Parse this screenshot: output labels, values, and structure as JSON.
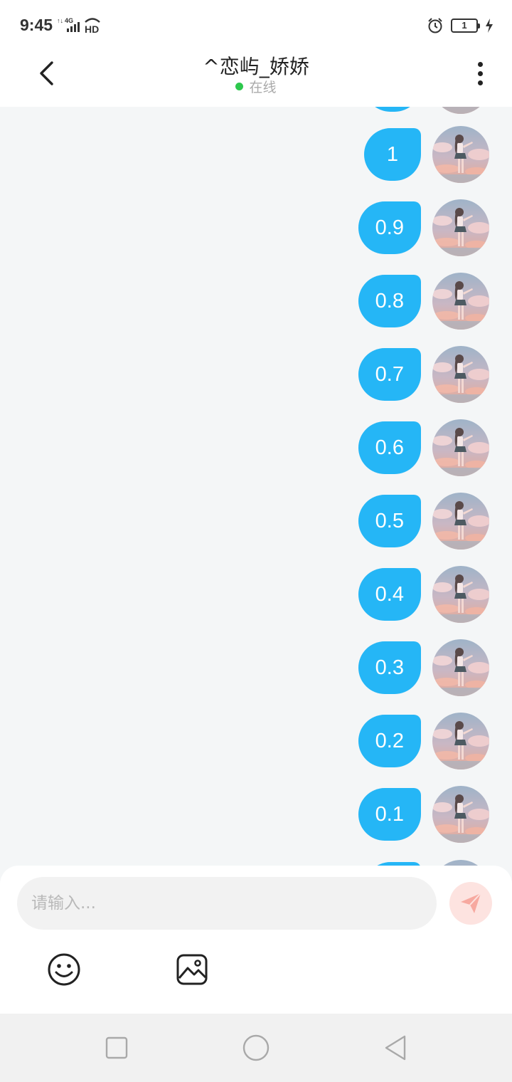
{
  "status_bar": {
    "time": "9:45",
    "network": "4G",
    "hd": "HD",
    "battery": "1"
  },
  "header": {
    "title": "^恋屿_娇娇",
    "status": "在线",
    "status_color": "#2dc84d"
  },
  "messages": [
    {
      "text": "1"
    },
    {
      "text": "0.9"
    },
    {
      "text": "0.8"
    },
    {
      "text": "0.7"
    },
    {
      "text": "0.6"
    },
    {
      "text": "0.5"
    },
    {
      "text": "0.4"
    },
    {
      "text": "0.3"
    },
    {
      "text": "0.2"
    },
    {
      "text": "0.1"
    }
  ],
  "input": {
    "placeholder": "请输入...",
    "value": ""
  },
  "colors": {
    "bubble": "#25b6f6",
    "send_button": "#fde3e0",
    "send_icon": "#f7a9a0"
  },
  "icons": {
    "back": "chevron-left-icon",
    "more": "more-vertical-icon",
    "send": "paper-plane-icon",
    "emoji": "smiley-icon",
    "image": "image-icon",
    "nav_recent": "square-icon",
    "nav_home": "circle-icon",
    "nav_back": "triangle-back-icon"
  }
}
